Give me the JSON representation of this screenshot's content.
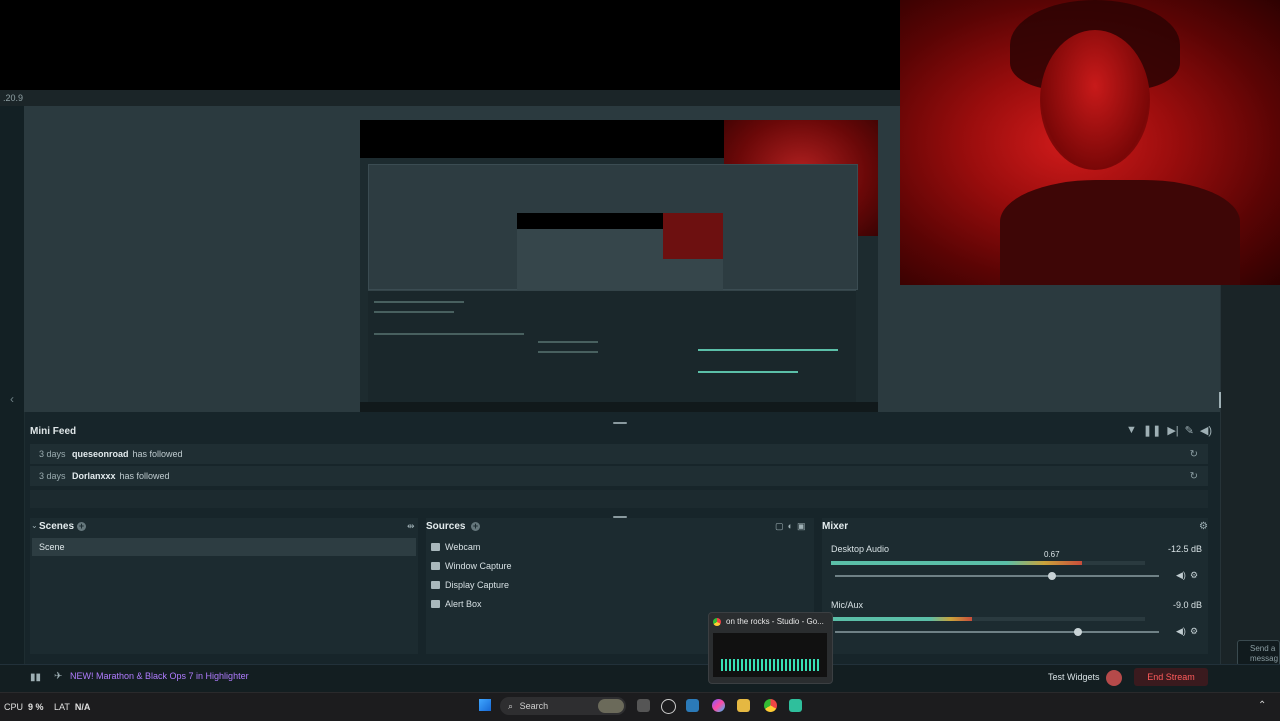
{
  "app": {
    "version": ".20.9"
  },
  "mini_feed": {
    "title": "Mini Feed",
    "items": [
      {
        "time": "3 days",
        "user": "queseonroad",
        "action": "has followed"
      },
      {
        "time": "3 days",
        "user": "Dorlanxxx",
        "action": "has followed"
      }
    ]
  },
  "scenes": {
    "title": "Scenes",
    "items": [
      "Scene"
    ]
  },
  "sources": {
    "title": "Sources",
    "items": [
      {
        "label": "Webcam",
        "icon": "camera-icon"
      },
      {
        "label": "Window Capture",
        "icon": "window-icon"
      },
      {
        "label": "Display Capture",
        "icon": "monitor-icon"
      },
      {
        "label": "Alert Box",
        "icon": "alert-icon"
      }
    ]
  },
  "mixer": {
    "title": "Mixer",
    "channels": [
      {
        "name": "Desktop Audio",
        "db": "-12.5 dB",
        "tooltip": "0.67",
        "level": 0.67,
        "meter": 0.8
      },
      {
        "name": "Mic/Aux",
        "db": "-9.0 dB",
        "level": 0.75,
        "meter": 0.45
      }
    ]
  },
  "footer": {
    "promo": "NEW! Marathon & Black Ops 7 in Highlighter",
    "test_widgets": "Test Widgets",
    "end_stream": "End Stream",
    "chat_placeholder_1": "Send a",
    "chat_placeholder_2": "messag"
  },
  "taskbar": {
    "cpu_label": "CPU",
    "cpu_value": "9 %",
    "lat_label": "LAT",
    "lat_value": "N/A",
    "search": "Search",
    "thumbnail_title": "on the rocks - Studio - Go..."
  },
  "colors": {
    "accent": "#5bbfa8",
    "end_stream": "#ff5b5b",
    "promo": "#b07cff",
    "background": "#17252a"
  }
}
